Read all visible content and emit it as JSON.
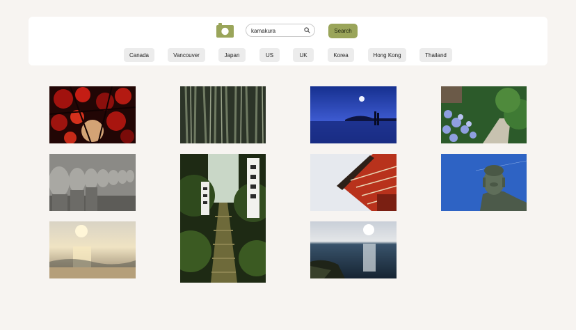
{
  "search": {
    "query": "kamakura",
    "button_label": "Search"
  },
  "icons": {
    "logo": "camera-icon",
    "search": "magnifier-icon"
  },
  "colors": {
    "background": "#f7f4f1",
    "header": "#ffffff",
    "accent": "#9aa55a",
    "chip": "#ececec"
  },
  "categories": [
    "Canada",
    "Vancouver",
    "Japan",
    "US",
    "UK",
    "Korea",
    "Hong Kong",
    "Thailand"
  ]
}
